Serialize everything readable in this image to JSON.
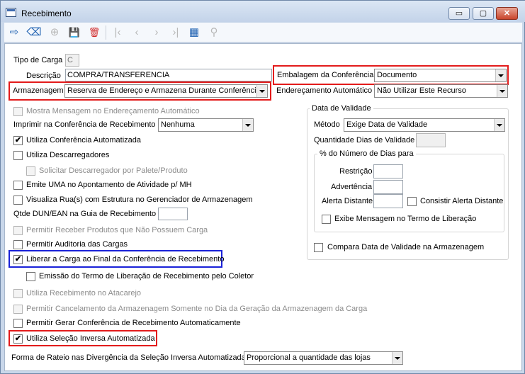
{
  "window": {
    "title": "Recebimento",
    "buttons": {
      "minimize": "▭",
      "maximize": "▢",
      "close": "✕"
    }
  },
  "toolbar": {
    "icons": [
      "exit-icon",
      "eraser-icon",
      "add-icon",
      "save-icon",
      "delete-icon",
      "first-icon",
      "prev-icon",
      "next-icon",
      "last-icon",
      "grid-icon",
      "search-icon"
    ],
    "glyphs": {
      "exit": "⇨",
      "eraser": "⌫",
      "add": "⊕",
      "save": "💾",
      "delete": "🗑",
      "first": "|‹",
      "prev": "‹",
      "next": "›",
      "last": "›|",
      "grid": "▦",
      "search": "⚲"
    }
  },
  "form": {
    "tipo_carga": {
      "label": "Tipo de Carga",
      "value": "C"
    },
    "descricao": {
      "label": "Descrição",
      "value": "COMPRA/TRANSFERENCIA"
    },
    "armazenagem": {
      "label": "Armazenagem",
      "value": "Reserva de Endereço e Armazena Durante Conferência"
    },
    "embalagem": {
      "label": "Embalagem da Conferência",
      "value": "Documento"
    },
    "enderecamento": {
      "label": "Endereçamento Automático",
      "value": "Não Utilizar Este Recurso"
    },
    "mostra_mensagem": {
      "label": "Mostra Mensagem no Endereçamento Automático",
      "checked": false
    },
    "imprimir": {
      "label": "Imprimir na Conferência de Recebimento",
      "value": "Nenhuma"
    },
    "utiliza_conferencia": {
      "label": "Utiliza Conferência Automatizada",
      "checked": true,
      "mark": "✔"
    },
    "utiliza_descarregadores": {
      "label": "Utiliza Descarregadores",
      "checked": false
    },
    "solicitar_descarregador": {
      "label": "Solicitar Descarregador por Palete/Produto",
      "checked": false
    },
    "emite_uma": {
      "label": "Emite UMA no Apontamento de Atividade p/ MH",
      "checked": false
    },
    "visualiza_rua": {
      "label": "Visualiza Rua(s) com Estrutura no Gerenciador de Armazenagem",
      "checked": false
    },
    "qtde_dun": {
      "label": "Qtde DUN/EAN na Guia de Recebimento",
      "value": ""
    },
    "permitir_receber": {
      "label": "Permitir Receber Produtos que Não Possuem Carga",
      "checked": false
    },
    "permitir_auditoria": {
      "label": "Permitir Auditoria das Cargas",
      "checked": false
    },
    "liberar_carga": {
      "label": "Liberar a Carga ao Final da Conferência de Recebimento",
      "checked": true,
      "mark": "✔"
    },
    "emissao_termo": {
      "label": "Emissão do Termo de Liberação de Recebimento pelo Coletor",
      "checked": false
    },
    "utiliza_atacarejo": {
      "label": "Utiliza Recebimento no Atacarejo",
      "checked": false
    },
    "permitir_cancelamento": {
      "label": "Permitir Cancelamento da Armazenagem Somente no Dia da Geração da Armazenagem da Carga",
      "checked": false
    },
    "permitir_gerar": {
      "label": "Permitir Gerar Conferência de Recebimento Automaticamente",
      "checked": false
    },
    "selecao_inversa": {
      "label": "Utiliza Seleção Inversa Automatizada",
      "checked": true,
      "mark": "✔"
    },
    "forma_rateio": {
      "label": "Forma de Rateio nas Divergência da Seleção Inversa Automatizada",
      "value": "Proporcional a quantidade das lojas"
    }
  },
  "validade": {
    "title": "Data de Validade",
    "metodo": {
      "label": "Método",
      "value": "Exige Data de Validade"
    },
    "quantidade_dias": {
      "label": "Quantidade Dias de Validade",
      "value": ""
    },
    "percentual": {
      "title": "% do Número de Dias para",
      "restricao": {
        "label": "Restrição",
        "value": ""
      },
      "advertencia": {
        "label": "Advertência",
        "value": ""
      },
      "alerta": {
        "label": "Alerta Distante",
        "value": ""
      },
      "consistir": {
        "label": "Consistir Alerta Distante",
        "checked": false
      },
      "exibe": {
        "label": "Exibe Mensagem no Termo de Liberação",
        "checked": false
      }
    },
    "compara": {
      "label": "Compara Data de Validade na Armazenagem",
      "checked": false
    }
  }
}
